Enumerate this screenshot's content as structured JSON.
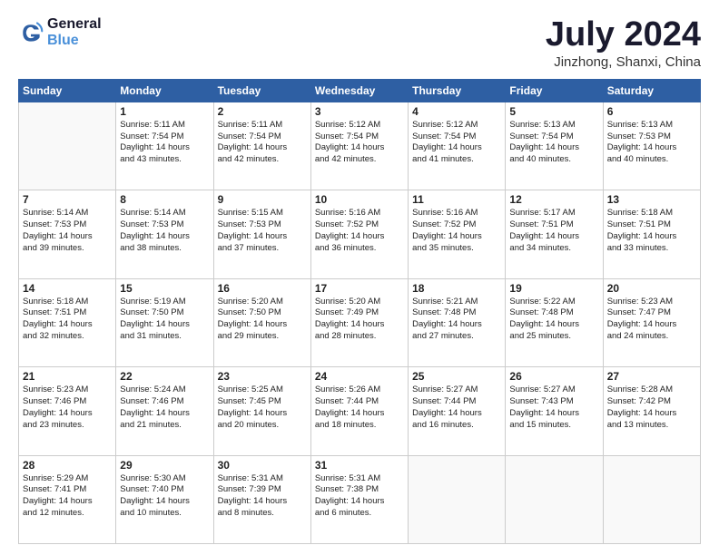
{
  "logo": {
    "line1": "General",
    "line2": "Blue"
  },
  "title": "July 2024",
  "location": "Jinzhong, Shanxi, China",
  "days_of_week": [
    "Sunday",
    "Monday",
    "Tuesday",
    "Wednesday",
    "Thursday",
    "Friday",
    "Saturday"
  ],
  "weeks": [
    [
      {
        "day": "",
        "info": ""
      },
      {
        "day": "1",
        "info": "Sunrise: 5:11 AM\nSunset: 7:54 PM\nDaylight: 14 hours\nand 43 minutes."
      },
      {
        "day": "2",
        "info": "Sunrise: 5:11 AM\nSunset: 7:54 PM\nDaylight: 14 hours\nand 42 minutes."
      },
      {
        "day": "3",
        "info": "Sunrise: 5:12 AM\nSunset: 7:54 PM\nDaylight: 14 hours\nand 42 minutes."
      },
      {
        "day": "4",
        "info": "Sunrise: 5:12 AM\nSunset: 7:54 PM\nDaylight: 14 hours\nand 41 minutes."
      },
      {
        "day": "5",
        "info": "Sunrise: 5:13 AM\nSunset: 7:54 PM\nDaylight: 14 hours\nand 40 minutes."
      },
      {
        "day": "6",
        "info": "Sunrise: 5:13 AM\nSunset: 7:53 PM\nDaylight: 14 hours\nand 40 minutes."
      }
    ],
    [
      {
        "day": "7",
        "info": "Sunrise: 5:14 AM\nSunset: 7:53 PM\nDaylight: 14 hours\nand 39 minutes."
      },
      {
        "day": "8",
        "info": "Sunrise: 5:14 AM\nSunset: 7:53 PM\nDaylight: 14 hours\nand 38 minutes."
      },
      {
        "day": "9",
        "info": "Sunrise: 5:15 AM\nSunset: 7:53 PM\nDaylight: 14 hours\nand 37 minutes."
      },
      {
        "day": "10",
        "info": "Sunrise: 5:16 AM\nSunset: 7:52 PM\nDaylight: 14 hours\nand 36 minutes."
      },
      {
        "day": "11",
        "info": "Sunrise: 5:16 AM\nSunset: 7:52 PM\nDaylight: 14 hours\nand 35 minutes."
      },
      {
        "day": "12",
        "info": "Sunrise: 5:17 AM\nSunset: 7:51 PM\nDaylight: 14 hours\nand 34 minutes."
      },
      {
        "day": "13",
        "info": "Sunrise: 5:18 AM\nSunset: 7:51 PM\nDaylight: 14 hours\nand 33 minutes."
      }
    ],
    [
      {
        "day": "14",
        "info": "Sunrise: 5:18 AM\nSunset: 7:51 PM\nDaylight: 14 hours\nand 32 minutes."
      },
      {
        "day": "15",
        "info": "Sunrise: 5:19 AM\nSunset: 7:50 PM\nDaylight: 14 hours\nand 31 minutes."
      },
      {
        "day": "16",
        "info": "Sunrise: 5:20 AM\nSunset: 7:50 PM\nDaylight: 14 hours\nand 29 minutes."
      },
      {
        "day": "17",
        "info": "Sunrise: 5:20 AM\nSunset: 7:49 PM\nDaylight: 14 hours\nand 28 minutes."
      },
      {
        "day": "18",
        "info": "Sunrise: 5:21 AM\nSunset: 7:48 PM\nDaylight: 14 hours\nand 27 minutes."
      },
      {
        "day": "19",
        "info": "Sunrise: 5:22 AM\nSunset: 7:48 PM\nDaylight: 14 hours\nand 25 minutes."
      },
      {
        "day": "20",
        "info": "Sunrise: 5:23 AM\nSunset: 7:47 PM\nDaylight: 14 hours\nand 24 minutes."
      }
    ],
    [
      {
        "day": "21",
        "info": "Sunrise: 5:23 AM\nSunset: 7:46 PM\nDaylight: 14 hours\nand 23 minutes."
      },
      {
        "day": "22",
        "info": "Sunrise: 5:24 AM\nSunset: 7:46 PM\nDaylight: 14 hours\nand 21 minutes."
      },
      {
        "day": "23",
        "info": "Sunrise: 5:25 AM\nSunset: 7:45 PM\nDaylight: 14 hours\nand 20 minutes."
      },
      {
        "day": "24",
        "info": "Sunrise: 5:26 AM\nSunset: 7:44 PM\nDaylight: 14 hours\nand 18 minutes."
      },
      {
        "day": "25",
        "info": "Sunrise: 5:27 AM\nSunset: 7:44 PM\nDaylight: 14 hours\nand 16 minutes."
      },
      {
        "day": "26",
        "info": "Sunrise: 5:27 AM\nSunset: 7:43 PM\nDaylight: 14 hours\nand 15 minutes."
      },
      {
        "day": "27",
        "info": "Sunrise: 5:28 AM\nSunset: 7:42 PM\nDaylight: 14 hours\nand 13 minutes."
      }
    ],
    [
      {
        "day": "28",
        "info": "Sunrise: 5:29 AM\nSunset: 7:41 PM\nDaylight: 14 hours\nand 12 minutes."
      },
      {
        "day": "29",
        "info": "Sunrise: 5:30 AM\nSunset: 7:40 PM\nDaylight: 14 hours\nand 10 minutes."
      },
      {
        "day": "30",
        "info": "Sunrise: 5:31 AM\nSunset: 7:39 PM\nDaylight: 14 hours\nand 8 minutes."
      },
      {
        "day": "31",
        "info": "Sunrise: 5:31 AM\nSunset: 7:38 PM\nDaylight: 14 hours\nand 6 minutes."
      },
      {
        "day": "",
        "info": ""
      },
      {
        "day": "",
        "info": ""
      },
      {
        "day": "",
        "info": ""
      }
    ]
  ]
}
